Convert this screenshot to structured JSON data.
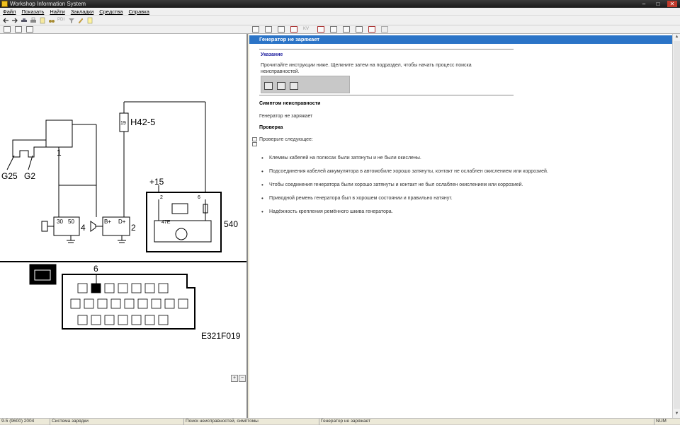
{
  "window": {
    "title": "Workshop Information System"
  },
  "menu": [
    "Файл",
    "Показать",
    "Найти",
    "Закладки",
    "Средства",
    "Справка"
  ],
  "toolbar": {
    "pdi_label": "PDI",
    "kv_label": "KV"
  },
  "diagram": {
    "connector_label": "H42-5",
    "pin_label": "19",
    "ground_labels": [
      "G25",
      "G2"
    ],
    "battery_id": "1",
    "starter_id": "4",
    "starter_pins": [
      "30",
      "50"
    ],
    "generator_id": "2",
    "generator_pins": [
      "B+",
      "D+"
    ],
    "module_id": "540",
    "module_supply": "+15",
    "module_pins": [
      "2",
      "6",
      "47E"
    ],
    "connector_pin_label": "6",
    "figure_code": "E321F019"
  },
  "content": {
    "header": "Генератор не заряжает",
    "note_title": "Указание",
    "note_text": "Прочитайте инструкции ниже. Щелкните затем на подраздел, чтобы начать процесс поиска неисправностей.",
    "symptom_heading": "Симптом неисправности",
    "symptom_text": "Генератор не заряжает",
    "check_heading": "Проверка",
    "check_intro": "Проверьте следующее:",
    "items": [
      "Клеммы кабелей на полюсах были затянуты и не были окислены.",
      "Подсоединения кабелей аккумулятора в автомобиле хорошо затянуты, контакт не ослаблен окислением или коррозией.",
      "Чтобы соединения генератора были хорошо затянуты и контакт не был ослаблен окислением или коррозией.",
      "Приводной ремень генератора был в хорошем состоянии и правильно натянут.",
      "Надёжность крепления ремённого шкива генератора."
    ]
  },
  "status": {
    "vehicle": "9-5 (9600) 2004",
    "system": "Система зарядки",
    "mode": "Поиск неисправностей, симптомы",
    "page": "Генератор не заряжает",
    "num": "NUM"
  }
}
